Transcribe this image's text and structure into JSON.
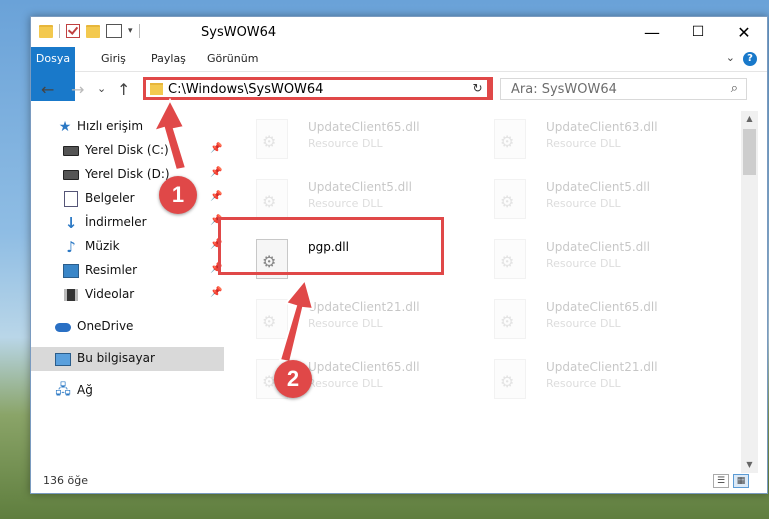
{
  "window": {
    "title": "SysWOW64",
    "controls": {
      "minimize": "—",
      "maximize": "☐",
      "close": "✕"
    }
  },
  "ribbon": {
    "tabs": [
      "Dosya",
      "Giriş",
      "Paylaş",
      "Görünüm"
    ],
    "help_icon": "?"
  },
  "nav": {
    "back": "←",
    "forward": "→",
    "recent": "⌄",
    "up": "↑",
    "address": "C:\\Windows\\SysWOW64",
    "refresh": "↻",
    "search_placeholder": "Ara: SysWOW64",
    "search_icon": "⌕"
  },
  "sidebar": {
    "items": [
      {
        "label": "Hızlı erişim",
        "icon": "star-icon"
      },
      {
        "label": "Yerel Disk (C:)",
        "icon": "drive-icon",
        "pinned": true
      },
      {
        "label": "Yerel Disk (D:)",
        "icon": "drive-icon",
        "pinned": true
      },
      {
        "label": "Belgeler",
        "icon": "documents-icon",
        "pinned": true
      },
      {
        "label": "İndirmeler",
        "icon": "download-icon",
        "pinned": true
      },
      {
        "label": "Müzik",
        "icon": "music-icon",
        "pinned": true
      },
      {
        "label": "Resimler",
        "icon": "pictures-icon",
        "pinned": true
      },
      {
        "label": "Videolar",
        "icon": "videos-icon",
        "pinned": true
      },
      {
        "label": "OneDrive",
        "icon": "cloud-icon"
      },
      {
        "label": "Bu bilgisayar",
        "icon": "computer-icon",
        "selected": true
      },
      {
        "label": "Ağ",
        "icon": "network-icon"
      }
    ]
  },
  "files": [
    {
      "name": "UpdateClient65.dll",
      "type": "Resource DLL",
      "faded": true
    },
    {
      "name": "UpdateClient63.dll",
      "type": "Resource DLL",
      "faded": true
    },
    {
      "name": "UpdateClient5.dll",
      "type": "Resource DLL",
      "faded": true
    },
    {
      "name": "UpdateClient5.dll",
      "type": "Resource DLL",
      "faded": true
    },
    {
      "name": "pgp.dll",
      "type": "",
      "faded": false
    },
    {
      "name": "UpdateClient5.dll",
      "type": "Resource DLL",
      "faded": true
    },
    {
      "name": "UpdateClient21.dll",
      "type": "Resource DLL",
      "faded": true
    },
    {
      "name": "UpdateClient65.dll",
      "type": "Resource DLL",
      "faded": true
    },
    {
      "name": "UpdateClient65.dll",
      "type": "Resource DLL",
      "faded": true
    },
    {
      "name": "UpdateClient21.dll",
      "type": "Resource DLL",
      "faded": true
    }
  ],
  "status": {
    "count": "136 öğe"
  },
  "markers": {
    "step1": "1",
    "step2": "2"
  },
  "colors": {
    "accent": "#1979ca",
    "highlight": "#e04848"
  }
}
